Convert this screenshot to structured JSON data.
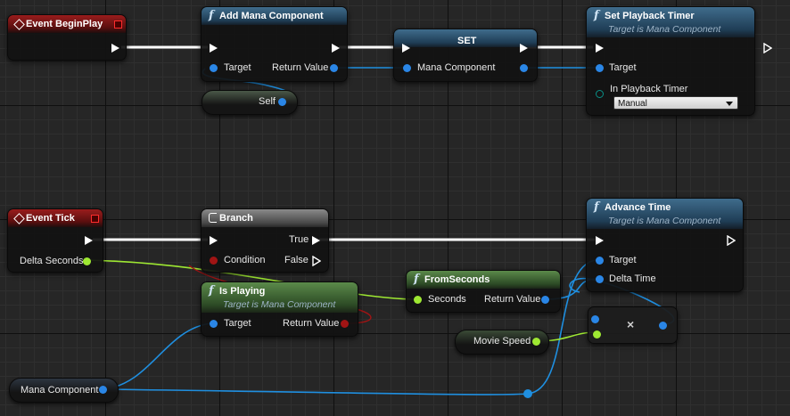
{
  "nodes": {
    "event_begin_play": {
      "title": "Event BeginPlay"
    },
    "add_mana_component": {
      "title": "Add Mana Component",
      "target_label": "Target",
      "return_label": "Return Value"
    },
    "self_node": {
      "label": "Self"
    },
    "set_node": {
      "title": "SET",
      "pin_label": "Mana Component"
    },
    "set_playback_timer": {
      "title": "Set Playback Timer",
      "subtitle": "Target is Mana Component",
      "target_label": "Target",
      "param_label": "In Playback Timer",
      "dropdown_value": "Manual"
    },
    "event_tick": {
      "title": "Event Tick",
      "delta_label": "Delta Seconds"
    },
    "branch": {
      "title": "Branch",
      "condition_label": "Condition",
      "true_label": "True",
      "false_label": "False"
    },
    "advance_time": {
      "title": "Advance Time",
      "subtitle": "Target is Mana Component",
      "target_label": "Target",
      "delta_label": "Delta Time"
    },
    "is_playing": {
      "title": "Is Playing",
      "subtitle": "Target is Mana Component",
      "target_label": "Target",
      "return_label": "Return Value"
    },
    "from_seconds": {
      "title": "FromSeconds",
      "seconds_label": "Seconds",
      "return_label": "Return Value"
    },
    "multiply": {
      "symbol": "×"
    },
    "movie_speed": {
      "label": "Movie Speed"
    },
    "mana_component_var": {
      "label": "Mana Component"
    }
  },
  "colors": {
    "exec_wire": "#ffffff",
    "object_wire": "#1f8fe0",
    "float_wire": "#9ee832",
    "bool_wire": "#a11414"
  },
  "icons": {
    "event": "diamond-icon",
    "function": "function-f-icon",
    "branch": "branch-icon"
  }
}
